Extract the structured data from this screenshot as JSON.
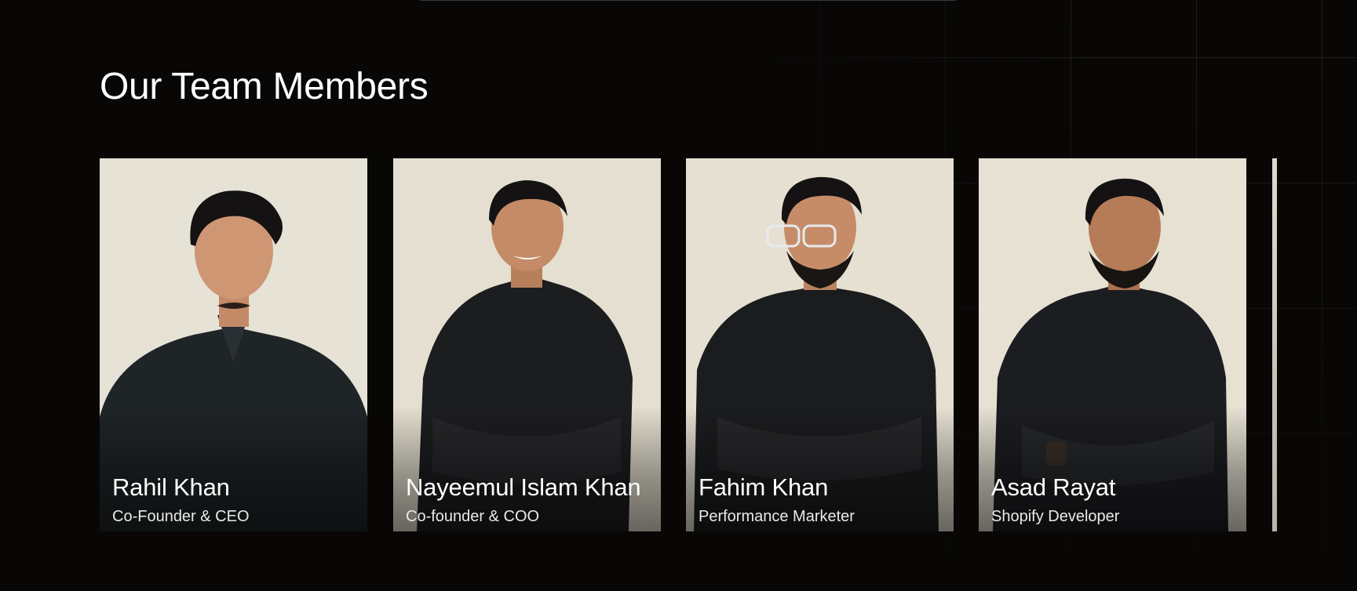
{
  "section": {
    "title": "Our Team Members"
  },
  "colors": {
    "background": "#080706",
    "title_text": "#ffffff",
    "card_background": "#e4e0d3",
    "shirt": "#1a1c1e",
    "hair": "#141212"
  },
  "team": [
    {
      "name": "Rahil Khan",
      "role": "Co-Founder & CEO"
    },
    {
      "name": "Nayeemul Islam Khan",
      "role": "Co-founder & COO"
    },
    {
      "name": "Fahim Khan",
      "role": "Performance Marketer"
    },
    {
      "name": "Asad Rayat",
      "role": "Shopify Developer"
    }
  ]
}
